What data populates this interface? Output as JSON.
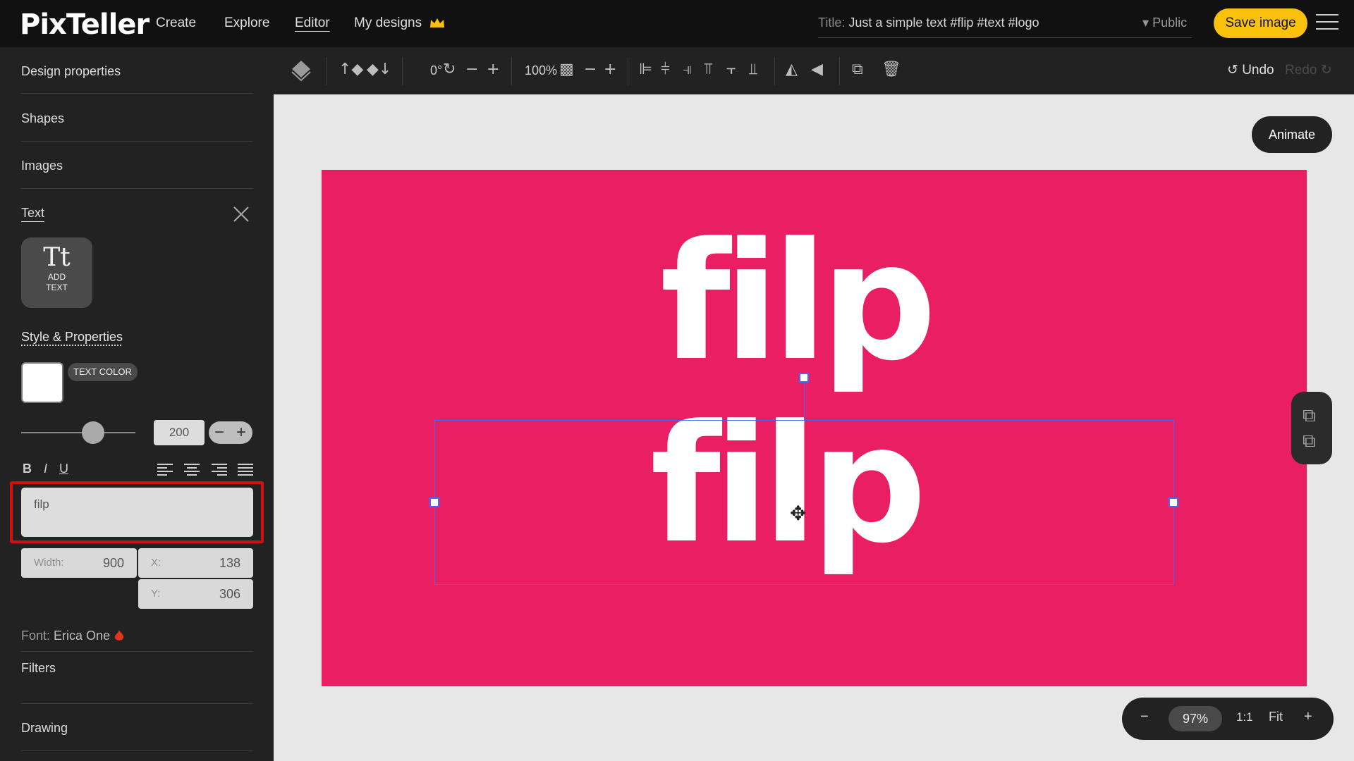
{
  "header": {
    "logo": "PixTeller",
    "nav": [
      "Create",
      "Explore",
      "Editor",
      "My designs"
    ],
    "title_label": "Title:",
    "title_value": "Just a simple text #flip #text #logo",
    "visibility": "Public",
    "save_label": "Save image"
  },
  "sidebar": {
    "items": [
      "Design properties",
      "Shapes",
      "Images",
      "Text"
    ],
    "add_text": [
      "ADD",
      "TEXT"
    ],
    "style_header": "Style & Properties",
    "text_color_label": "TEXT COLOR",
    "font_size": "200",
    "bold": "B",
    "italic": "I",
    "underline": "U",
    "text_value": "filp",
    "width_label": "Width:",
    "width_value": "900",
    "x_label": "X:",
    "x_value": "138",
    "y_label": "Y:",
    "y_value": "306",
    "font_label": "Font:",
    "font_value": "Erica One",
    "filters": "Filters",
    "drawing": "Drawing"
  },
  "toolbar": {
    "rotation": "0°",
    "opacity": "100%",
    "undo": "Undo",
    "redo": "Redo"
  },
  "canvas": {
    "animate_label": "Animate",
    "design_bg": "#e91e63",
    "text_top": "filp",
    "text_bottom": "filp"
  },
  "zoom": {
    "value": "97%",
    "one_to_one": "1:1",
    "fit": "Fit"
  }
}
